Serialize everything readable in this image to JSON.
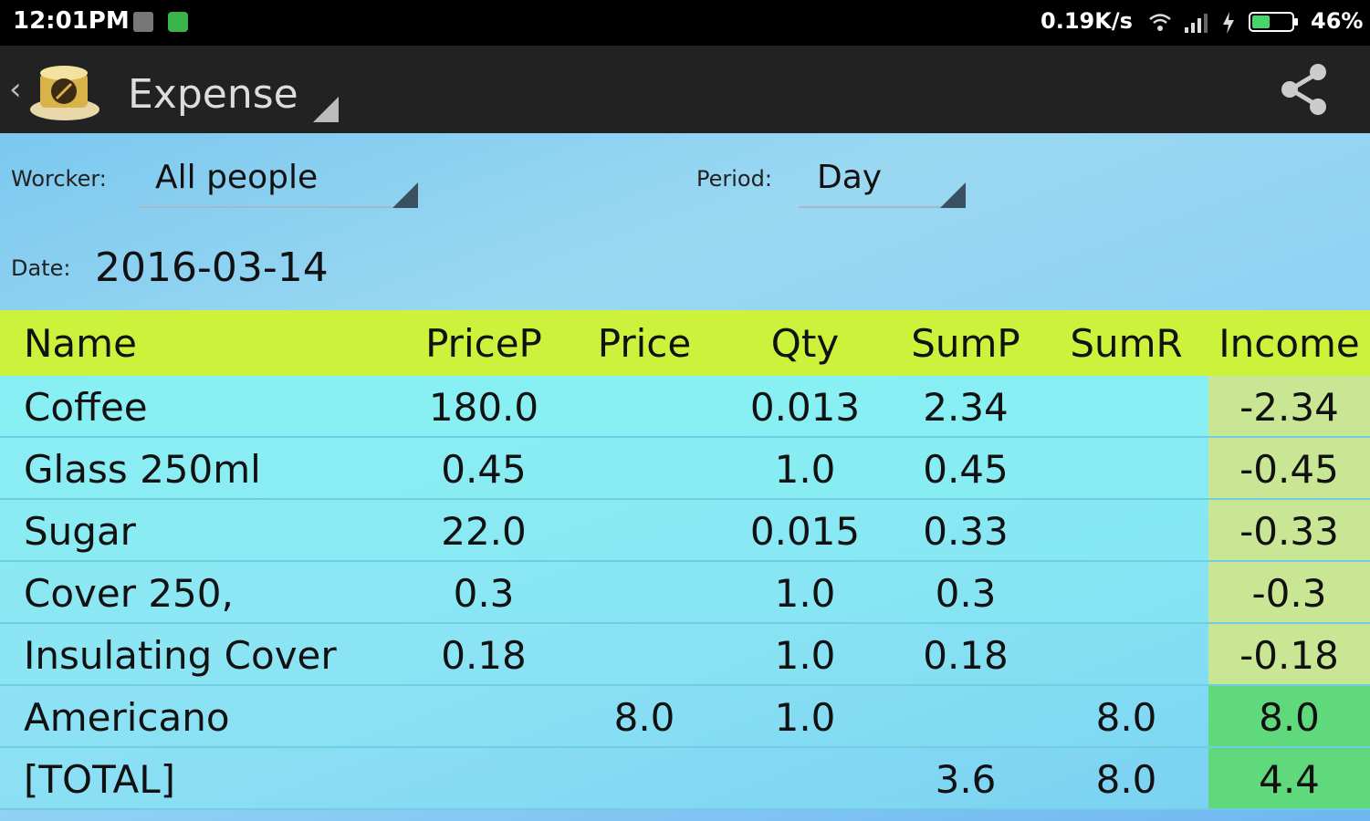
{
  "status_bar": {
    "time": "12:01PM",
    "speed": "0.19K/s",
    "battery": "46%",
    "battery_level": 0.46
  },
  "action_bar": {
    "title": "Expense",
    "icons": [
      "back-caret-icon",
      "app-logo-icon",
      "share-icon"
    ]
  },
  "filters": {
    "worker_label": "Worcker:",
    "worker_value": "All people",
    "period_label": "Period:",
    "period_value": "Day",
    "date_label": "Date:",
    "date_value": "2016-03-14"
  },
  "table": {
    "columns": [
      "Name",
      "PriceP",
      "Price",
      "Qty",
      "SumP",
      "SumR",
      "Income"
    ],
    "rows": [
      {
        "name": "Coffee",
        "pricep": "180.0",
        "price": "",
        "qty": "0.013",
        "sump": "2.34",
        "sumr": "",
        "income": "-2.34",
        "income_color": "#c8e693"
      },
      {
        "name": "Glass 250ml",
        "pricep": "0.45",
        "price": "",
        "qty": "1.0",
        "sump": "0.45",
        "sumr": "",
        "income": "-0.45",
        "income_color": "#c8e693"
      },
      {
        "name": "Sugar",
        "pricep": "22.0",
        "price": "",
        "qty": "0.015",
        "sump": "0.33",
        "sumr": "",
        "income": "-0.33",
        "income_color": "#c8e693"
      },
      {
        "name": "Cover 250,",
        "pricep": "0.3",
        "price": "",
        "qty": "1.0",
        "sump": "0.3",
        "sumr": "",
        "income": "-0.3",
        "income_color": "#c8e693"
      },
      {
        "name": "Insulating Cover",
        "pricep": "0.18",
        "price": "",
        "qty": "1.0",
        "sump": "0.18",
        "sumr": "",
        "income": "-0.18",
        "income_color": "#c8e693"
      },
      {
        "name": "Americano",
        "pricep": "",
        "price": "8.0",
        "qty": "1.0",
        "sump": "",
        "sumr": "8.0",
        "income": "8.0",
        "income_color": "#5fd97c"
      },
      {
        "name": "[TOTAL]",
        "pricep": "",
        "price": "",
        "qty": "",
        "sump": "3.6",
        "sumr": "8.0",
        "income": "4.4",
        "income_color": "#5fd97c"
      }
    ]
  },
  "colors": {
    "header_bg": "#ccf23c",
    "row_bg": "#86f2f3",
    "negative_income": "#c8e693",
    "positive_income": "#5fd97c"
  }
}
